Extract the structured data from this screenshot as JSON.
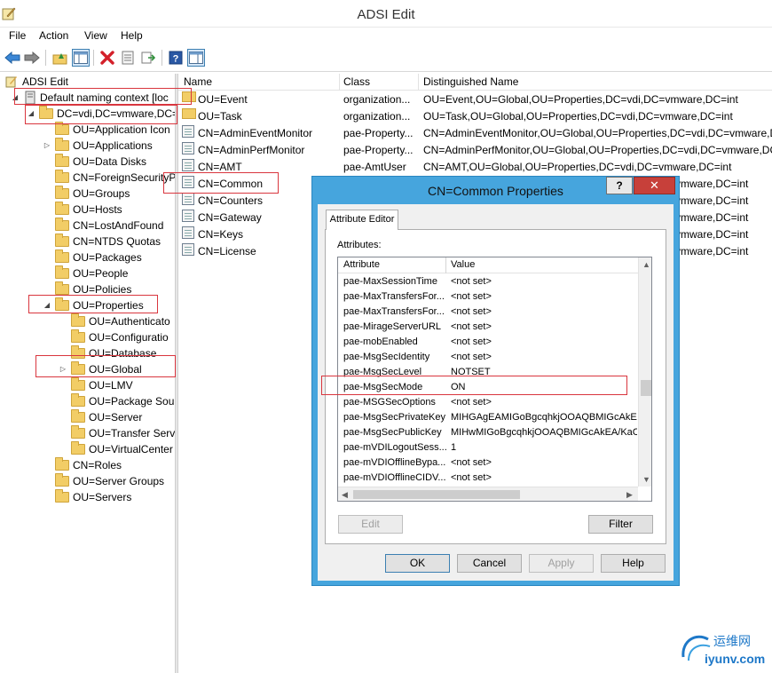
{
  "window": {
    "title": "ADSI Edit"
  },
  "menu": [
    "File",
    "Action",
    "View",
    "Help"
  ],
  "toolbar": {
    "icons": [
      "back-icon",
      "forward-icon",
      "up-folder-icon",
      "show-hide-tree-icon",
      "delete-icon",
      "properties-icon",
      "export-list-icon",
      "help-icon",
      "show-action-pane-icon"
    ]
  },
  "tree": {
    "root": "ADSI Edit",
    "connection": "Default naming context [loc",
    "domain": "DC=vdi,DC=vmware,DC=",
    "level1": [
      "OU=Application Icon",
      "OU=Applications",
      "OU=Data Disks",
      "CN=ForeignSecurityP",
      "OU=Groups",
      "OU=Hosts",
      "CN=LostAndFound",
      "CN=NTDS Quotas",
      "OU=Packages",
      "OU=People",
      "OU=Policies",
      "OU=Properties"
    ],
    "level2": [
      "OU=Authenticato",
      "OU=Configuratio",
      "OU=Database",
      "OU=Global",
      "OU=LMV",
      "OU=Package Sou",
      "OU=Server",
      "OU=Transfer Serv",
      "OU=VirtualCenter"
    ],
    "level1_after": [
      "CN=Roles",
      "OU=Server Groups",
      "OU=Servers"
    ]
  },
  "list": {
    "headers": [
      "Name",
      "Class",
      "Distinguished Name"
    ],
    "rows": [
      {
        "name": "OU=Event",
        "class": "organization...",
        "dn": "OU=Event,OU=Global,OU=Properties,DC=vdi,DC=vmware,DC=int",
        "icon": "folder-icon"
      },
      {
        "name": "OU=Task",
        "class": "organization...",
        "dn": "OU=Task,OU=Global,OU=Properties,DC=vdi,DC=vmware,DC=int",
        "icon": "folder-icon"
      },
      {
        "name": "CN=AdminEventMonitor",
        "class": "pae-Property...",
        "dn": "CN=AdminEventMonitor,OU=Global,OU=Properties,DC=vdi,DC=vmware,DC=int",
        "icon": "document-icon"
      },
      {
        "name": "CN=AdminPerfMonitor",
        "class": "pae-Property...",
        "dn": "CN=AdminPerfMonitor,OU=Global,OU=Properties,DC=vdi,DC=vmware,DC=int",
        "icon": "document-icon"
      },
      {
        "name": "CN=AMT",
        "class": "pae-AmtUser",
        "dn": "CN=AMT,OU=Global,OU=Properties,DC=vdi,DC=vmware,DC=int",
        "icon": "document-icon"
      },
      {
        "name": "CN=Common",
        "class": "",
        "dn": "vmware,DC=int",
        "icon": "document-icon"
      },
      {
        "name": "CN=Counters",
        "class": "",
        "dn": "vmware,DC=int",
        "icon": "document-icon"
      },
      {
        "name": "CN=Gateway",
        "class": "",
        "dn": "vmware,DC=int",
        "icon": "document-icon"
      },
      {
        "name": "CN=Keys",
        "class": "",
        "dn": "vmware,DC=int",
        "icon": "document-icon"
      },
      {
        "name": "CN=License",
        "class": "",
        "dn": "vmware,DC=int",
        "icon": "document-icon"
      }
    ]
  },
  "dialog": {
    "title": "CN=Common Properties",
    "help_label": "?",
    "close_label": "✕",
    "tab": "Attribute Editor",
    "attributes_label": "Attributes:",
    "headers": [
      "Attribute",
      "Value"
    ],
    "rows": [
      {
        "attr": "pae-MaxSessionTime",
        "value": "<not set>"
      },
      {
        "attr": "pae-MaxTransfersFor...",
        "value": "<not set>"
      },
      {
        "attr": "pae-MaxTransfersFor...",
        "value": "<not set>"
      },
      {
        "attr": "pae-MirageServerURL",
        "value": "<not set>"
      },
      {
        "attr": "pae-mobEnabled",
        "value": "<not set>"
      },
      {
        "attr": "pae-MsgSecIdentity",
        "value": "<not set>"
      },
      {
        "attr": "pae-MsgSecLevel",
        "value": "NOTSET"
      },
      {
        "attr": "pae-MsgSecMode",
        "value": "ON"
      },
      {
        "attr": "pae-MSGSecOptions",
        "value": "<not set>"
      },
      {
        "attr": "pae-MsgSecPrivateKey",
        "value": "MIHGAgEAMIGoBgcqhkjOOAQBMIGcAkEA"
      },
      {
        "attr": "pae-MsgSecPublicKey",
        "value": "MIHwMIGoBgcqhkjOOAQBMIGcAkEA/KaC"
      },
      {
        "attr": "pae-mVDILogoutSess...",
        "value": "1"
      },
      {
        "attr": "pae-mVDIOfflineBypa...",
        "value": "<not set>"
      },
      {
        "attr": "pae-mVDIOfflineCIDV...",
        "value": "<not set>"
      }
    ],
    "edit_label": "Edit",
    "filter_label": "Filter",
    "ok_label": "OK",
    "cancel_label": "Cancel",
    "apply_label": "Apply",
    "help_button_label": "Help"
  },
  "watermark": {
    "line1": "运维网",
    "line2": "iyunv.com"
  },
  "colors": {
    "dialog_frame": "#46a5dd",
    "highlight_box": "#d9363e",
    "close_button": "#c7403a"
  }
}
